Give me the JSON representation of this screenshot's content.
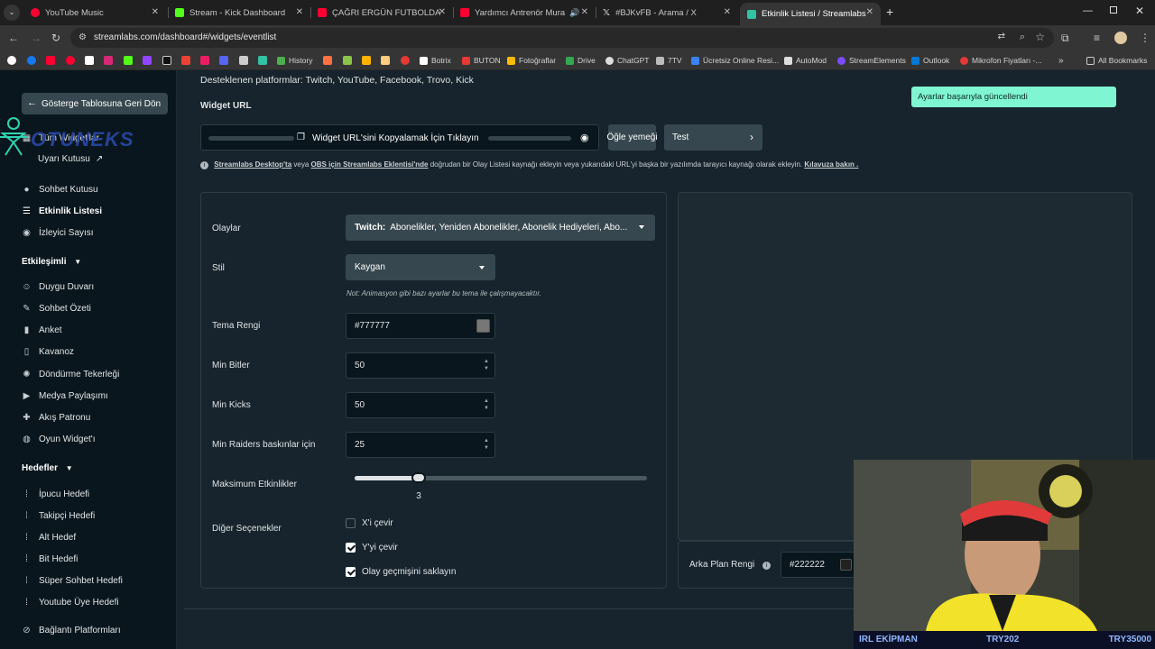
{
  "tabs": [
    {
      "title": "YouTube Music",
      "color": "#ff0033"
    },
    {
      "title": "Stream - Kick Dashboard",
      "color": "#53fc18"
    },
    {
      "title": "ÇAĞRI ERGÜN FUTBOLDA NE K",
      "color": "#ff0033"
    },
    {
      "title": "Yardımcı Antrenör Murat Ka",
      "color": "#ff0033"
    },
    {
      "title": "#BJKvFB - Arama / X",
      "color": "#ffffff"
    },
    {
      "title": "Etkinlik Listesi / Streamlabs",
      "color": "#31c3a2"
    }
  ],
  "address": {
    "url": "streamlabs.com/dashboard#/widgets/eventlist"
  },
  "bookmarks": [
    {
      "label": "History",
      "color": "#4caf50"
    },
    {
      "label": "Botrix",
      "color": "#ffffff"
    },
    {
      "label": "BUTON",
      "color": "#e53935"
    },
    {
      "label": "Fotoğraflar",
      "color": "#fbbc04"
    },
    {
      "label": "Drive",
      "color": "#34a853"
    },
    {
      "label": "ChatGPT",
      "color": "#dddddd"
    },
    {
      "label": "7TV",
      "color": "#bbbbbb"
    },
    {
      "label": "Ücretsiz Online Resi...",
      "color": "#3b82f6"
    },
    {
      "label": "AutoMod",
      "color": "#dddddd"
    },
    {
      "label": "StreamElements",
      "color": "#7c4dff"
    },
    {
      "label": "Outlook",
      "color": "#0078d4"
    },
    {
      "label": "Mikrofon Fiyatları -...",
      "color": "#e53935"
    }
  ],
  "all_bookmarks": "All Bookmarks",
  "sidebar": {
    "back": "Gösterge Tablosuna Geri Dön",
    "logo": "OTUNEKS",
    "items_top": [
      {
        "label": "Tüm Widget'lar",
        "icon": "grid-icon"
      },
      {
        "label": "Uyarı Kutusu",
        "icon": "external-link-icon"
      },
      {
        "label": "Sohbet Kutusu",
        "icon": "chat-icon"
      },
      {
        "label": "Etkinlik Listesi",
        "icon": "list-icon"
      },
      {
        "label": "İzleyici Sayısı",
        "icon": "eye-icon"
      }
    ],
    "section_engage": "Etkileşimli",
    "items_engage": [
      {
        "label": "Duygu Duvarı",
        "icon": "emoji-icon"
      },
      {
        "label": "Sohbet Özeti",
        "icon": "pen-icon"
      },
      {
        "label": "Anket",
        "icon": "bar-icon"
      },
      {
        "label": "Kavanoz",
        "icon": "jar-icon"
      },
      {
        "label": "Döndürme Tekerleği",
        "icon": "wheel-icon"
      },
      {
        "label": "Medya Paylaşımı",
        "icon": "media-icon"
      },
      {
        "label": "Akış Patronu",
        "icon": "boss-icon"
      },
      {
        "label": "Oyun Widget'ı",
        "icon": "game-icon"
      }
    ],
    "section_goals": "Hedefler",
    "items_goals": [
      {
        "label": "İpucu Hedefi",
        "icon": "tip-icon"
      },
      {
        "label": "Takipçi Hedefi",
        "icon": "follower-icon"
      },
      {
        "label": "Alt Hedef",
        "icon": "sub-icon"
      },
      {
        "label": "Bit Hedefi",
        "icon": "bit-icon"
      },
      {
        "label": "Süper Sohbet Hedefi",
        "icon": "superchat-icon"
      },
      {
        "label": "Youtube Üye Hedefi",
        "icon": "member-icon"
      }
    ],
    "connect": "Bağlantı Platformları"
  },
  "content": {
    "platforms": "Desteklenen platformlar: Twitch, YouTube, Facebook, Trovo, Kick",
    "widget_url_title": "Widget URL",
    "copy_label": "Widget URL'sini Kopyalamak İçin Tıklayın",
    "lunch_label": "Öğle yemeği",
    "test_label": "Test",
    "info_link1": "Streamlabs Desktop'ta",
    "info_veya": "veya",
    "info_link2": "OBS için Streamlabs Eklentisi'nde",
    "info_rest": "doğrudan bir Olay Listesi kaynağı ekleyin veya yukarıdaki URL'yi başka bir yazılımda tarayıcı kaynağı olarak ekleyin.",
    "info_guide": "Kılavuza bakın .",
    "toast": "Ayarlar başarıyla güncellendi",
    "form": {
      "events_label": "Olaylar",
      "events_prefix": "Twitch:",
      "events_value": "Abonelikler, Yeniden Abonelikler, Abonelik Hediyeleri, Abo...",
      "style_label": "Stil",
      "style_value": "Kaygan",
      "style_note": "Not: Animasyon gibi bazı ayarlar bu tema ile çalışmayacaktır.",
      "theme_label": "Tema Rengi",
      "theme_value": "#777777",
      "min_bits_label": "Min Bitler",
      "min_bits_value": "50",
      "min_kicks_label": "Min Kicks",
      "min_kicks_value": "50",
      "min_raiders_label": "Min Raiders baskınlar için",
      "min_raiders_value": "25",
      "max_events_label": "Maksimum Etkinlikler",
      "max_events_value": "3",
      "max_events_fill": 0.22,
      "other_label": "Diğer Seçenekler",
      "opt_flip_x": "X'i çevir",
      "opt_flip_y": "Y'yi çevir",
      "opt_keep_history": "Olay geçmişini saklayın",
      "flip_x_checked": false,
      "flip_y_checked": true,
      "keep_history_checked": true
    },
    "bg_label": "Arka Plan Rengi",
    "bg_value": "#222222"
  },
  "webcam": {
    "left_text": "IRL EKİPMAN",
    "mid_text": "TRY202",
    "right_text": "TRY35000"
  }
}
